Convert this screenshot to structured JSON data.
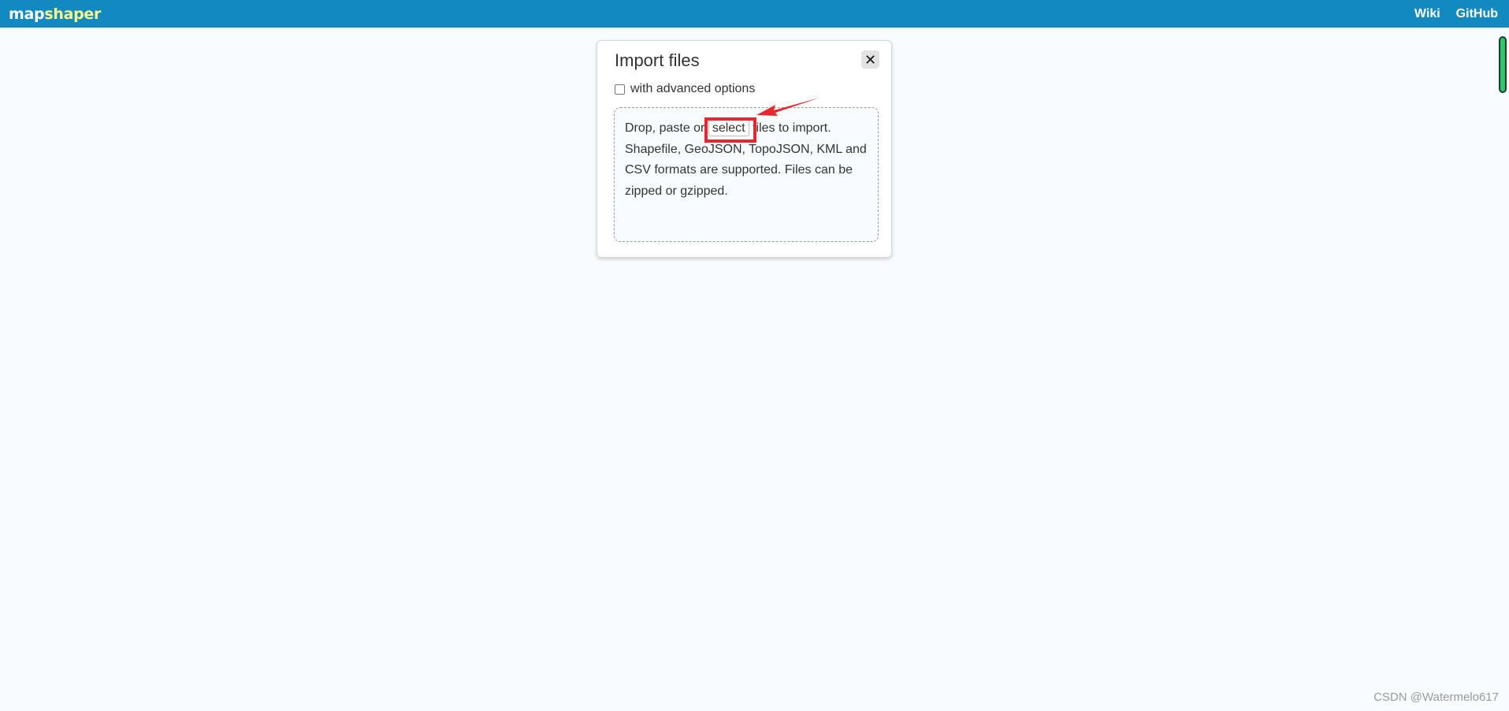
{
  "header": {
    "logo_part1": "map",
    "logo_part2": "shaper",
    "nav": [
      {
        "label": "Wiki"
      },
      {
        "label": "GitHub"
      }
    ]
  },
  "dialog": {
    "title": "Import files",
    "close_glyph": "✕",
    "advanced_label": "with advanced options",
    "advanced_checked": false,
    "drop_text_before": "Drop, paste or ",
    "select_label": "select",
    "drop_text_after": " files to import. Shapefile, GeoJSON, TopoJSON, KML and CSV formats are supported. Files can be zipped or gzipped."
  },
  "annotation": {
    "color": "#e8262d"
  },
  "watermark": "CSDN @Watermelo617",
  "colors": {
    "topbar": "#1289bf",
    "background": "#f7fdff",
    "logo_accent": "#fff58a"
  },
  "icons": {
    "close": "close-icon",
    "scroll": "scroll-indicator"
  }
}
